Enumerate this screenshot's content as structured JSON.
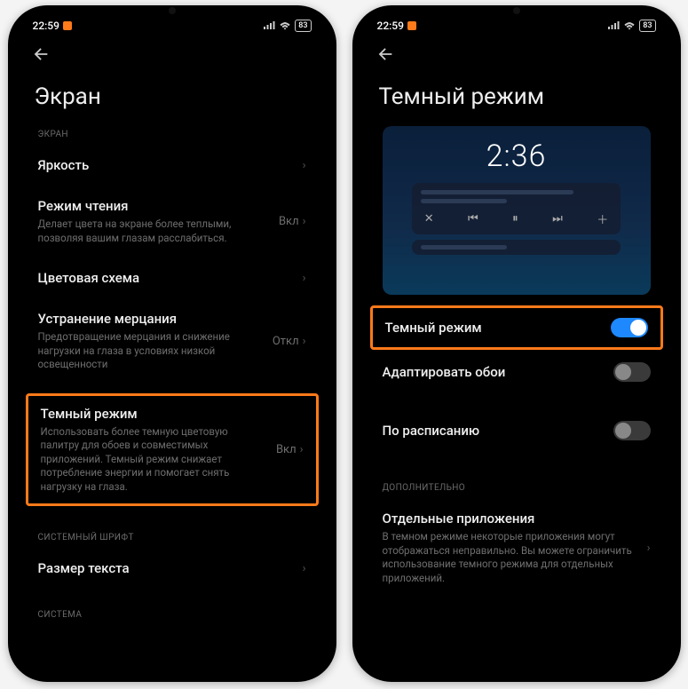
{
  "status": {
    "time": "22:59",
    "battery": "83"
  },
  "phone1": {
    "title": "Экран",
    "section_screen": "ЭКРАН",
    "brightness": {
      "title": "Яркость"
    },
    "reading": {
      "title": "Режим чтения",
      "desc": "Делает цвета на экране более теплыми, позволяя вашим глазам расслабиться.",
      "value": "Вкл"
    },
    "color": {
      "title": "Цветовая схема"
    },
    "flicker": {
      "title": "Устранение мерцания",
      "desc": "Предотвращение мерцания и снижение нагрузки на глаза в условиях низкой освещенности",
      "value": "Откл"
    },
    "darkmode": {
      "title": "Темный режим",
      "desc": "Использовать более темную цветовую палитру для обоев и совместимых приложений. Темный режим снижает потребление энергии и помогает снять нагрузку на глаза.",
      "value": "Вкл"
    },
    "section_font": "СИСТЕМНЫЙ ШРИФТ",
    "textsize": {
      "title": "Размер текста"
    },
    "section_system": "СИСТЕМА"
  },
  "phone2": {
    "title": "Темный режим",
    "preview_time": "2:36",
    "toggle_dark": {
      "title": "Темный режим",
      "on": true
    },
    "toggle_wall": {
      "title": "Адаптировать обои",
      "on": false
    },
    "toggle_sched": {
      "title": "По расписанию",
      "on": false
    },
    "section_more": "ДОПОЛНИТЕЛЬНО",
    "apps": {
      "title": "Отдельные приложения",
      "desc": "В темном режиме некоторые приложения могут отображаться неправильно. Вы можете ограничить использование темного режима для отдельных приложений."
    }
  }
}
